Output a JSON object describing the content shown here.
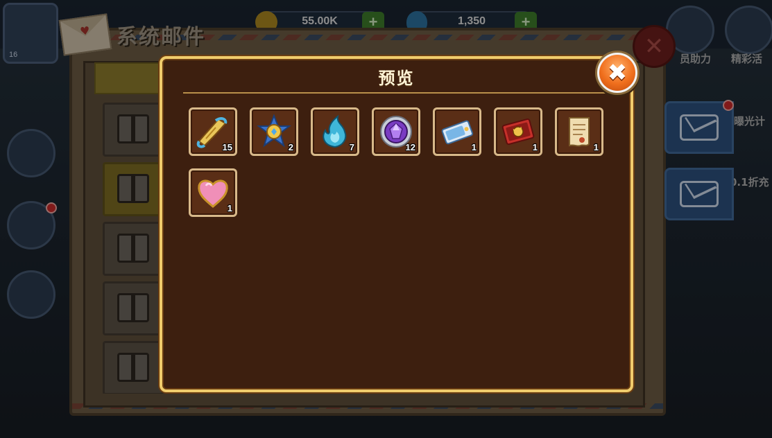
{
  "background": {
    "player_level": "16",
    "resources": [
      {
        "value": "55.00K",
        "icon": "coin-icon"
      },
      {
        "value": "1,350",
        "icon": "gem-icon"
      }
    ],
    "right_labels": [
      "员助力",
      "精彩活",
      "曝光计",
      "0.1折充"
    ],
    "mail_window_title": "系统邮件"
  },
  "modal": {
    "title": "预览",
    "close_icon": "close-x-icon",
    "close_glyph": "✖",
    "items": [
      {
        "icon": "golden-scroll-icon",
        "count": "15"
      },
      {
        "icon": "star-medal-icon",
        "count": "2"
      },
      {
        "icon": "blue-flame-icon",
        "count": "7"
      },
      {
        "icon": "purple-gem-icon",
        "count": "12"
      },
      {
        "icon": "ticket-icon",
        "count": "1"
      },
      {
        "icon": "red-card-icon",
        "count": "1"
      },
      {
        "icon": "parchment-scroll-icon",
        "count": "1"
      },
      {
        "icon": "pink-heart-icon",
        "count": "1"
      }
    ]
  },
  "colors": {
    "modal_bg": "#3d1f0f",
    "modal_border": "#f0cc6c",
    "item_border": "#d8b98a",
    "close_orange": "#f06f1d"
  }
}
